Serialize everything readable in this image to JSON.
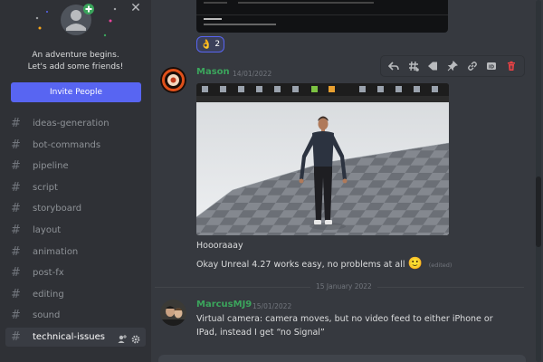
{
  "sidebar": {
    "invite_card": {
      "title": "An adventure begins.",
      "subtitle": "Let's add some friends!",
      "invite_button": "Invite People"
    },
    "channels": [
      {
        "label": "ideas-generation"
      },
      {
        "label": "bot-commands"
      },
      {
        "label": "pipeline"
      },
      {
        "label": "script"
      },
      {
        "label": "storyboard"
      },
      {
        "label": "layout"
      },
      {
        "label": "animation"
      },
      {
        "label": "post-fx"
      },
      {
        "label": "editing"
      },
      {
        "label": "sound"
      },
      {
        "label": "technical-issues",
        "active": true
      }
    ],
    "hash_symbol": "#"
  },
  "messages": {
    "previous_reaction": {
      "emoji": "👌",
      "count": "2"
    },
    "mason": {
      "username": "Mason",
      "timestamp": "14/01/2022",
      "lines": [
        "Hoooraaay",
        "Okay Unreal 4.27 works easy, no problems at all"
      ],
      "emoji": "🙂",
      "edited": "(edited)"
    },
    "divider": {
      "date": "15 January 2022"
    },
    "marcus": {
      "username": "MarcusMJ9",
      "timestamp": "15/01/2022",
      "lines": [
        "Virtual camera: camera moves, but no video feed to either iPhone or",
        "IPad, instead I get “no Signal”"
      ]
    }
  },
  "toolbar_icons": [
    "reply-icon",
    "thread-icon",
    "tag-icon",
    "pin-icon",
    "link-icon",
    "id-icon",
    "delete-icon"
  ],
  "colors": {
    "sidebar_bg": "#2f3136",
    "main_bg": "#36393f",
    "accent": "#5865f2",
    "username_green": "#3ba55c",
    "danger": "#ed4245"
  }
}
